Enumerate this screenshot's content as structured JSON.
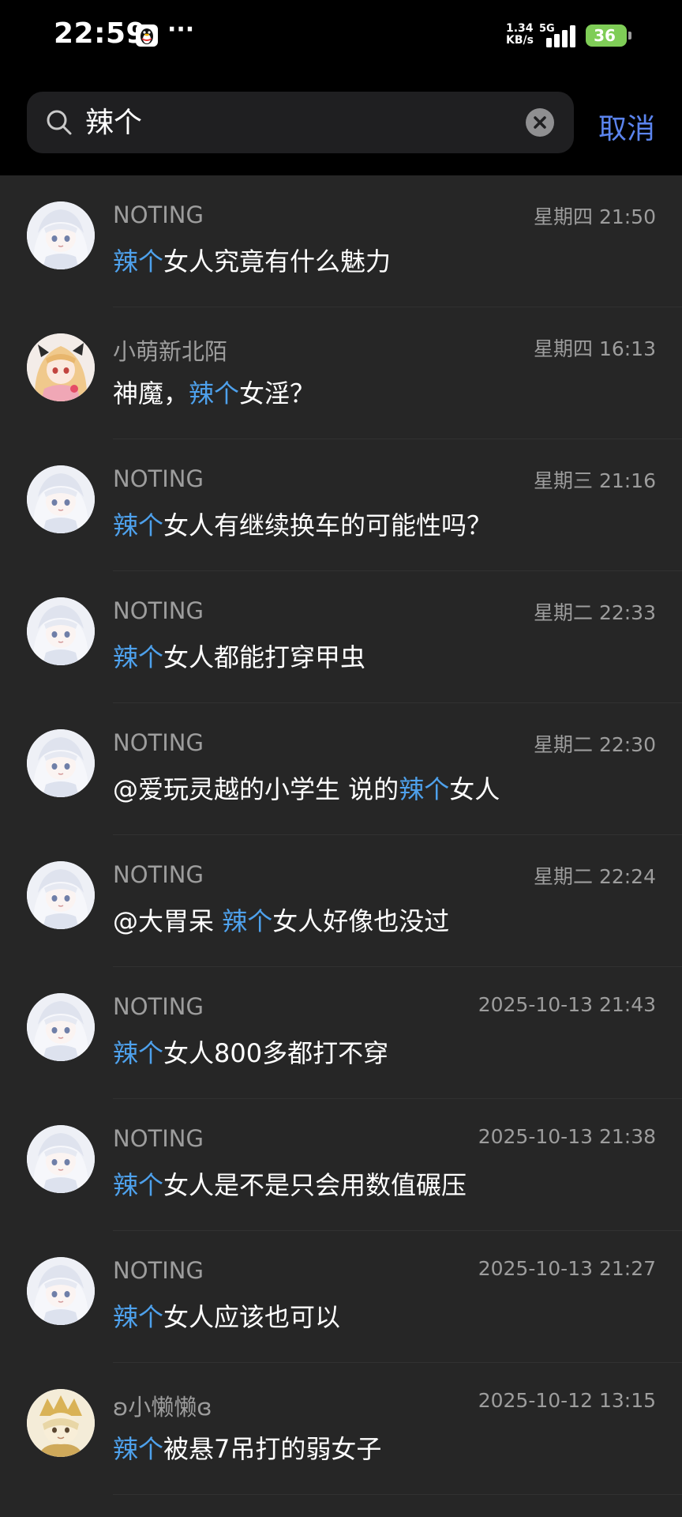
{
  "status_bar": {
    "time": "22:59",
    "more": "···",
    "net_speed_value": "1.34",
    "net_speed_unit": "KB/s",
    "network": "5G",
    "battery": "36",
    "icons": [
      "qq-icon",
      "signal-icon",
      "battery-icon"
    ]
  },
  "search": {
    "query": "辣个",
    "cancel_label": "取消",
    "icons": [
      "search-icon",
      "clear-icon"
    ]
  },
  "colors": {
    "accent_blue": "#5b84ee",
    "highlight_blue": "#4ea1ec",
    "list_background": "#262626",
    "battery_green": "#7fcd57"
  },
  "results": [
    {
      "sender": "NOTING",
      "time": "星期四 21:50",
      "avatar": "white-hair-girl",
      "pre": "",
      "match": "辣个",
      "post": "女人究竟有什么魅力"
    },
    {
      "sender": "小萌新北陌",
      "time": "星期四 16:13",
      "avatar": "blonde-girl",
      "pre": "神魔，",
      "match": "辣个",
      "post": "女淫？"
    },
    {
      "sender": "NOTING",
      "time": "星期三 21:16",
      "avatar": "white-hair-girl",
      "pre": "",
      "match": "辣个",
      "post": "女人有继续换车的可能性吗？"
    },
    {
      "sender": "NOTING",
      "time": "星期二 22:33",
      "avatar": "white-hair-girl",
      "pre": "",
      "match": "辣个",
      "post": "女人都能打穿甲虫"
    },
    {
      "sender": "NOTING",
      "time": "星期二 22:30",
      "avatar": "white-hair-girl",
      "pre": "@爱玩灵越的小学生  说的",
      "match": "辣个",
      "post": "女人"
    },
    {
      "sender": "NOTING",
      "time": "星期二 22:24",
      "avatar": "white-hair-girl",
      "pre": "@大胃呆  ",
      "match": "辣个",
      "post": "女人好像也没过"
    },
    {
      "sender": "NOTING",
      "time": "2025-10-13 21:43",
      "avatar": "white-hair-girl",
      "pre": "",
      "match": "辣个",
      "post": "女人800多都打不穿"
    },
    {
      "sender": "NOTING",
      "time": "2025-10-13 21:38",
      "avatar": "white-hair-girl",
      "pre": "",
      "match": "辣个",
      "post": "女人是不是只会用数值碾压"
    },
    {
      "sender": "NOTING",
      "time": "2025-10-13 21:27",
      "avatar": "white-hair-girl",
      "pre": "",
      "match": "辣个",
      "post": "女人应该也可以"
    },
    {
      "sender": "ʚ小懒懒ɞ",
      "time": "2025-10-12 13:15",
      "avatar": "golden-crown-character",
      "pre": "",
      "match": "辣个",
      "post": "被悬7吊打的弱女子"
    }
  ]
}
